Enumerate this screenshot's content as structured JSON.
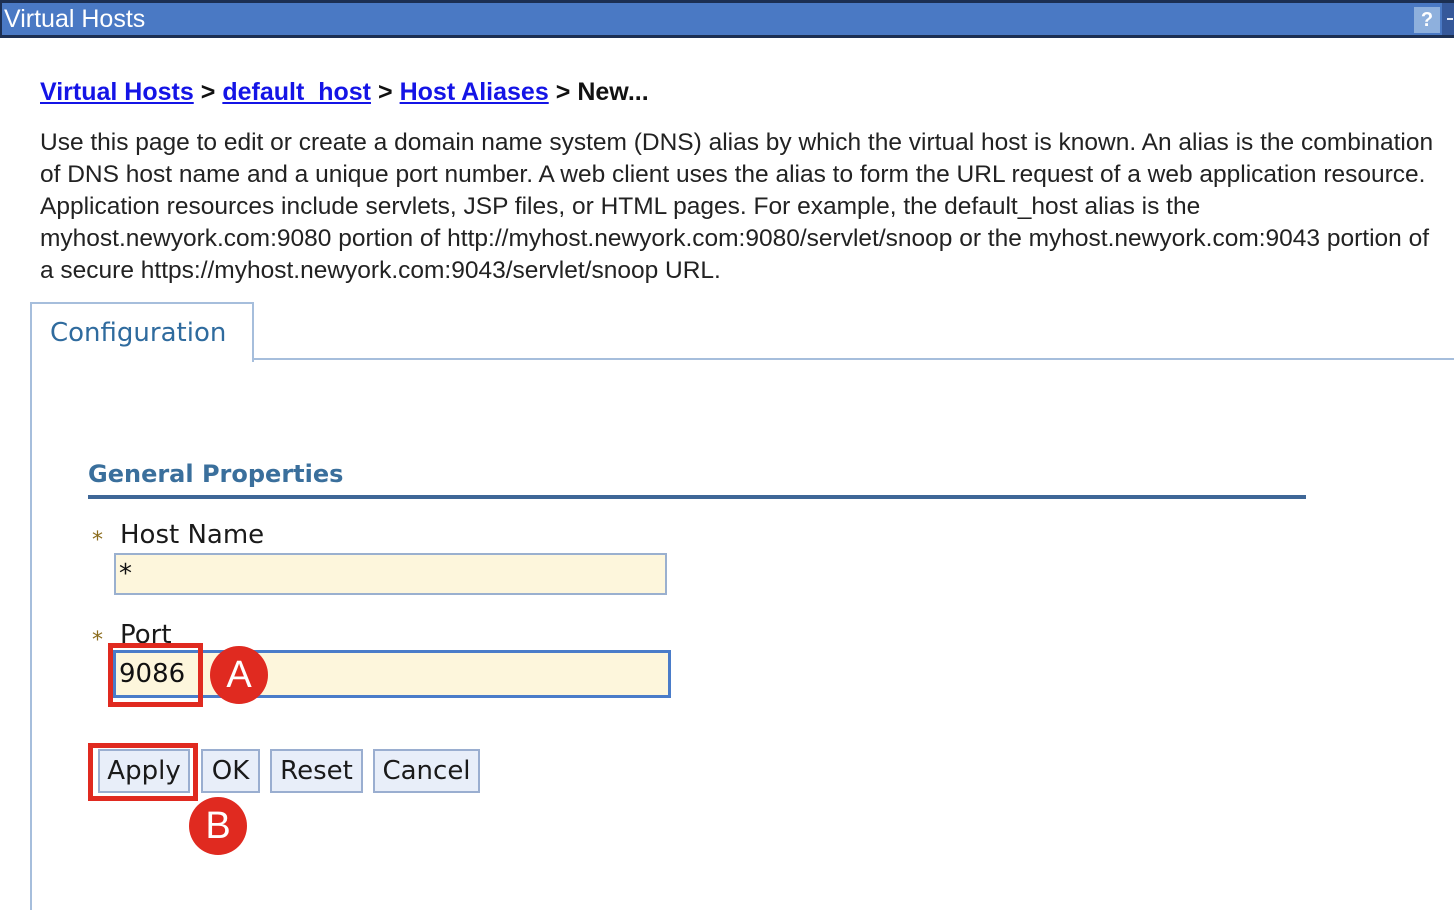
{
  "window": {
    "title": "Virtual Hosts",
    "help_label": "?"
  },
  "breadcrumb": {
    "items": [
      "Virtual Hosts",
      "default_host",
      "Host Aliases"
    ],
    "separator": ">",
    "current": "New..."
  },
  "description": "Use this page to edit or create a domain name system (DNS) alias by which the virtual host is known. An alias is the combination of DNS host name and a unique port number. A web client uses the alias to form the URL request of a web application resource. Application resources include servlets, JSP files, or HTML pages. For example, the default_host alias is the myhost.newyork.com:9080 portion of http://myhost.newyork.com:9080/servlet/snoop or the myhost.newyork.com:9043 portion of a secure https://myhost.newyork.com:9043/servlet/snoop URL.",
  "tabs": [
    {
      "label": "Configuration",
      "active": true
    }
  ],
  "general_properties": {
    "heading": "General Properties",
    "required_mark": "*",
    "host_name": {
      "label": "Host Name",
      "value": "*"
    },
    "port": {
      "label": "Port",
      "value": "9086"
    }
  },
  "buttons": {
    "apply": "Apply",
    "ok": "OK",
    "reset": "Reset",
    "cancel": "Cancel"
  },
  "annotations": {
    "a": "A",
    "b": "B",
    "highlight_color": "#e02a20"
  },
  "colors": {
    "titlebar": "#4a79c4",
    "link": "#1414e6",
    "field_bg": "#fdf6dc",
    "heading": "#3a6f9c"
  }
}
